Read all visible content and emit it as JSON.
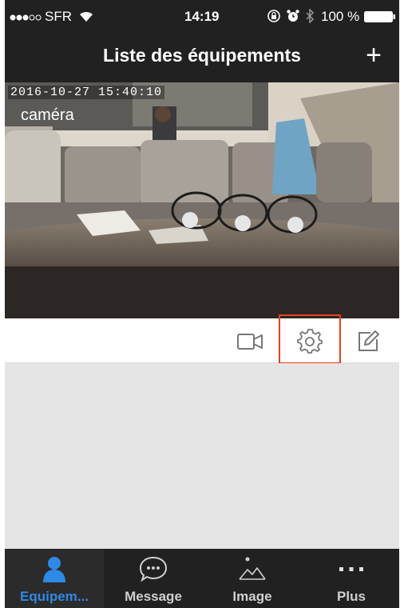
{
  "statusbar": {
    "carrier": "SFR",
    "time": "14:19",
    "battery": "100 %",
    "icons": [
      "signal-dots-icon",
      "wifi-icon",
      "rotation-lock-icon",
      "alarm-icon",
      "bluetooth-icon",
      "battery-icon"
    ]
  },
  "navbar": {
    "title": "Liste des équipements",
    "add_label": "+"
  },
  "camera": {
    "timestamp": "2016-10-27  15:40:10",
    "name": "caméra"
  },
  "toolbar": {
    "icons": [
      "video-camera-icon",
      "gear-icon",
      "edit-icon"
    ],
    "highlight_color": "#e8401c"
  },
  "tabs": [
    {
      "label": "Equipem...",
      "icon": "person-icon",
      "active": true
    },
    {
      "label": "Message",
      "icon": "chat-bubble-icon",
      "active": false
    },
    {
      "label": "Image",
      "icon": "mountain-image-icon",
      "active": false
    },
    {
      "label": "Plus",
      "icon": "more-dots-icon",
      "active": false
    }
  ],
  "colors": {
    "bar_background": "#212121",
    "accent": "#2f89e6",
    "content_background": "#e5e5e5"
  }
}
